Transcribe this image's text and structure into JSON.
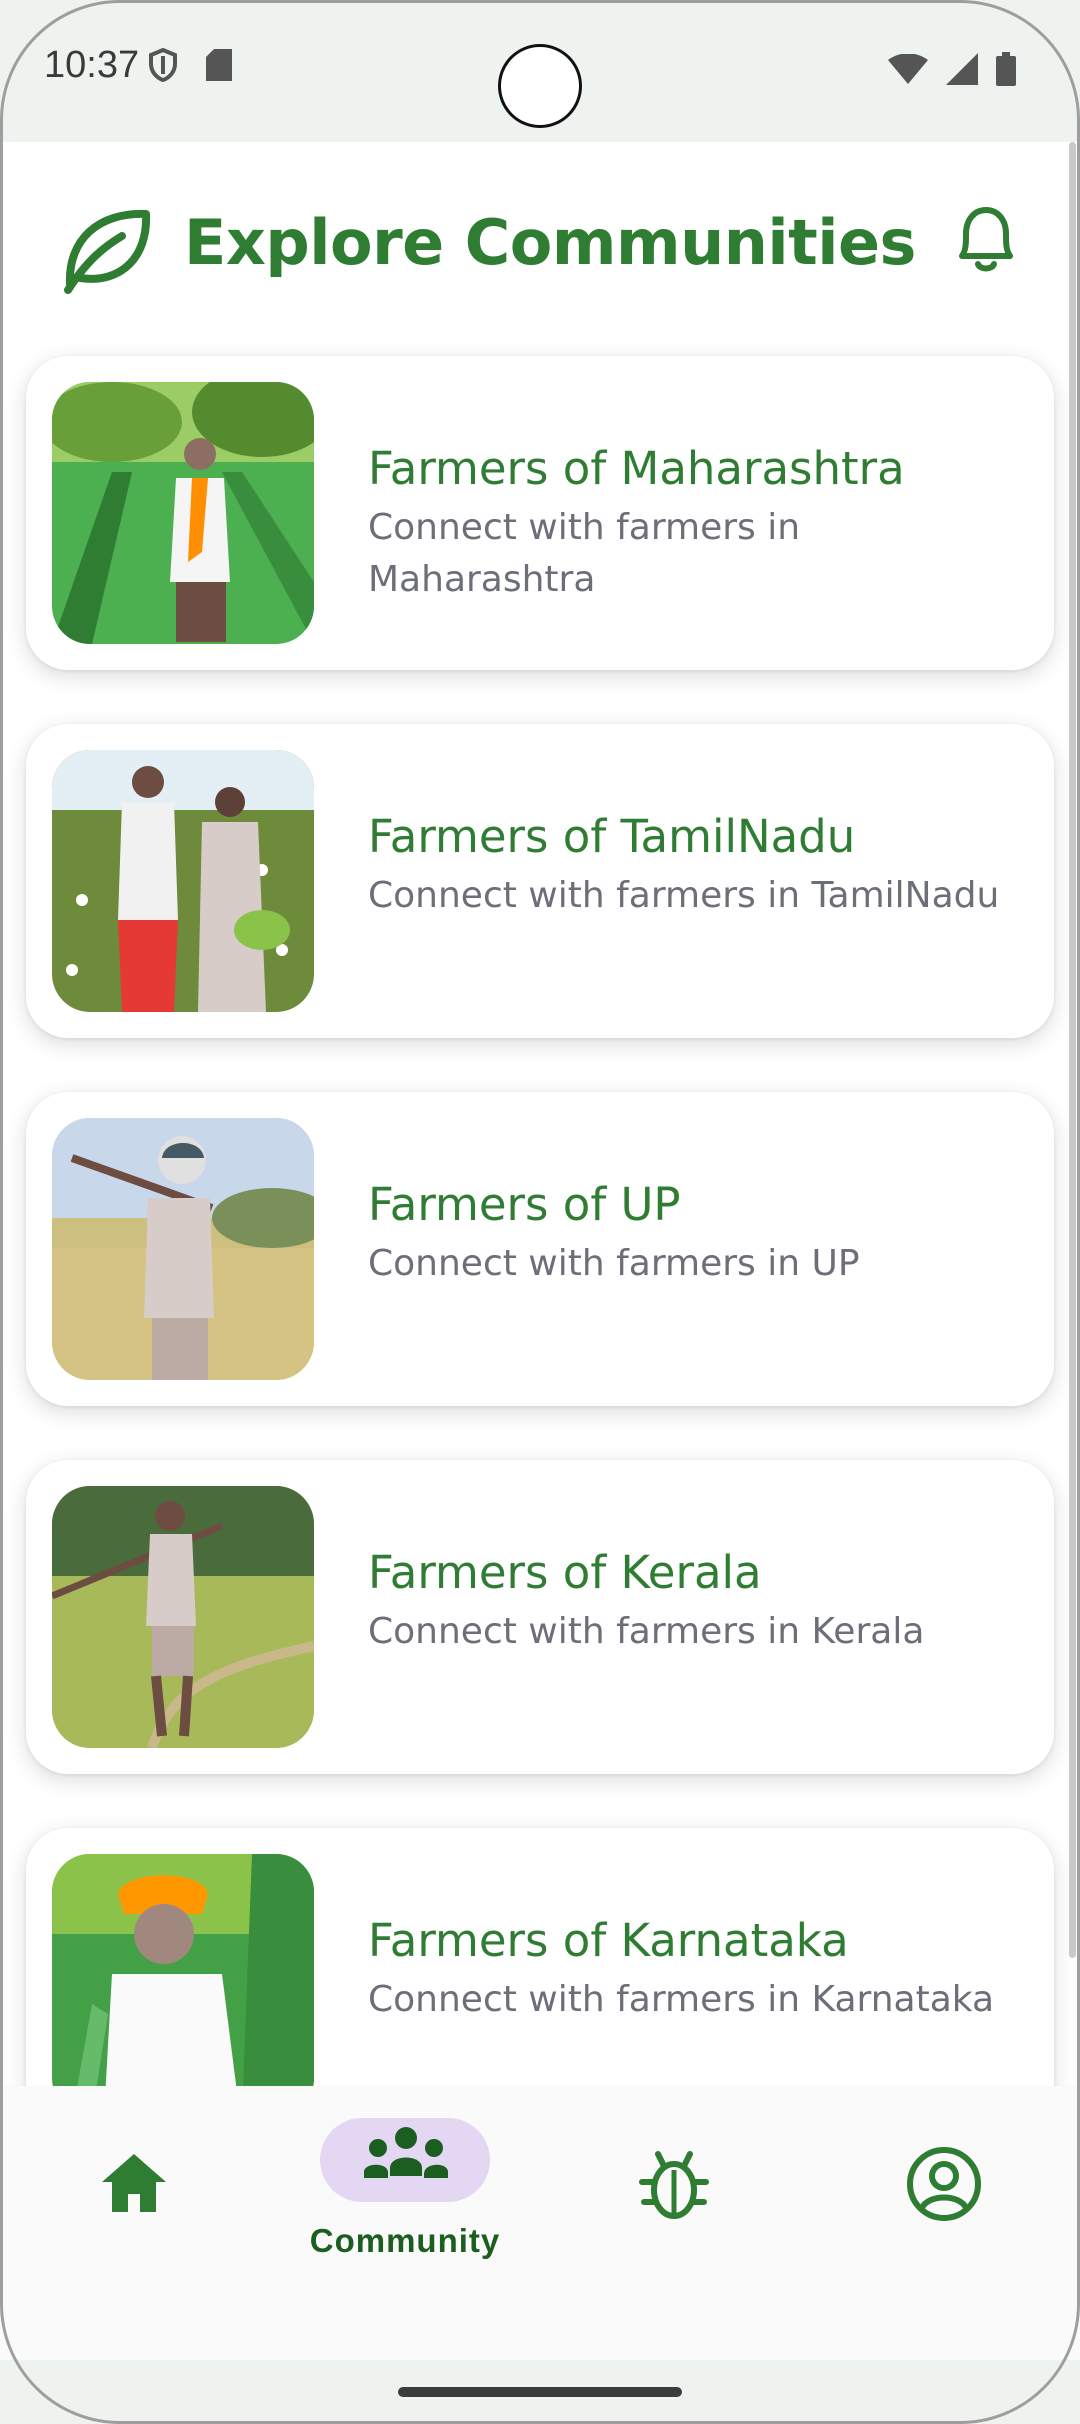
{
  "status_bar": {
    "time": "10:37",
    "left_icons": [
      "shield-icon",
      "sd-card-icon"
    ],
    "right_icons": [
      "wifi-icon",
      "signal-icon",
      "battery-icon"
    ]
  },
  "header": {
    "title": "Explore Communities",
    "logo_icon": "leaf-icon",
    "action_icon": "bell-icon"
  },
  "communities": [
    {
      "title": "Farmers of Maharashtra",
      "subtitle": "Connect with farmers in Maharashtra"
    },
    {
      "title": "Farmers of TamilNadu",
      "subtitle": "Connect with farmers in TamilNadu"
    },
    {
      "title": "Farmers of UP",
      "subtitle": "Connect with farmers in UP"
    },
    {
      "title": "Farmers of Kerala",
      "subtitle": "Connect with farmers in Kerala"
    },
    {
      "title": "Farmers of Karnataka",
      "subtitle": "Connect with farmers in Karnataka"
    }
  ],
  "bottom_nav": {
    "items": [
      {
        "icon": "home-icon",
        "label": ""
      },
      {
        "icon": "community-icon",
        "label": "Community",
        "active": true
      },
      {
        "icon": "bug-icon",
        "label": ""
      },
      {
        "icon": "profile-icon",
        "label": ""
      }
    ]
  },
  "colors": {
    "brand_green": "#2e7d32",
    "subtitle_gray": "#6d6f78",
    "active_pill": "#e4d7f3"
  }
}
